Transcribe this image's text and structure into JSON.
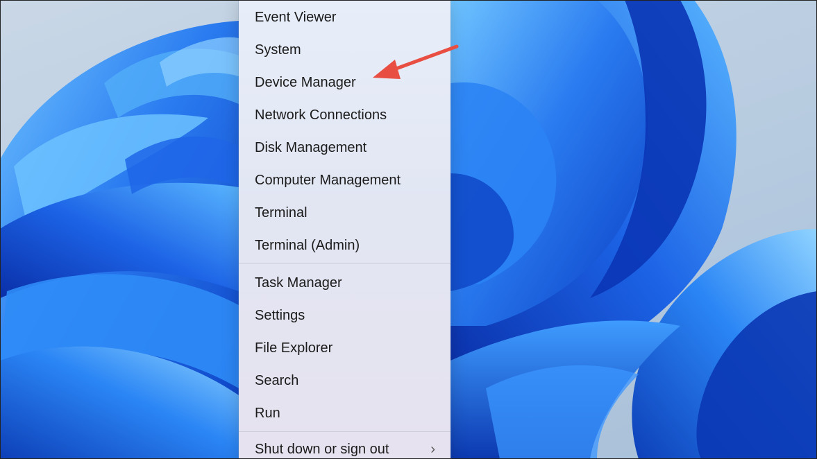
{
  "context_menu": {
    "group_one": [
      {
        "label": "Event Viewer"
      },
      {
        "label": "System"
      },
      {
        "label": "Device Manager"
      },
      {
        "label": "Network Connections"
      },
      {
        "label": "Disk Management"
      },
      {
        "label": "Computer Management"
      },
      {
        "label": "Terminal"
      },
      {
        "label": "Terminal (Admin)"
      }
    ],
    "group_two": [
      {
        "label": "Task Manager"
      },
      {
        "label": "Settings"
      },
      {
        "label": "File Explorer"
      },
      {
        "label": "Search"
      },
      {
        "label": "Run"
      }
    ],
    "group_three": [
      {
        "label": "Shut down or sign out",
        "has_submenu": true
      }
    ],
    "submenu_chevron": "›"
  },
  "colors": {
    "arrow": "#e94e43",
    "wallpaper_blue": "#1a5fe0",
    "wallpaper_light": "#4fb0ff",
    "menu_text": "#1b1b1b"
  },
  "icons": {
    "annotation": "red-arrow-icon",
    "submenu": "chevron-right-icon"
  }
}
